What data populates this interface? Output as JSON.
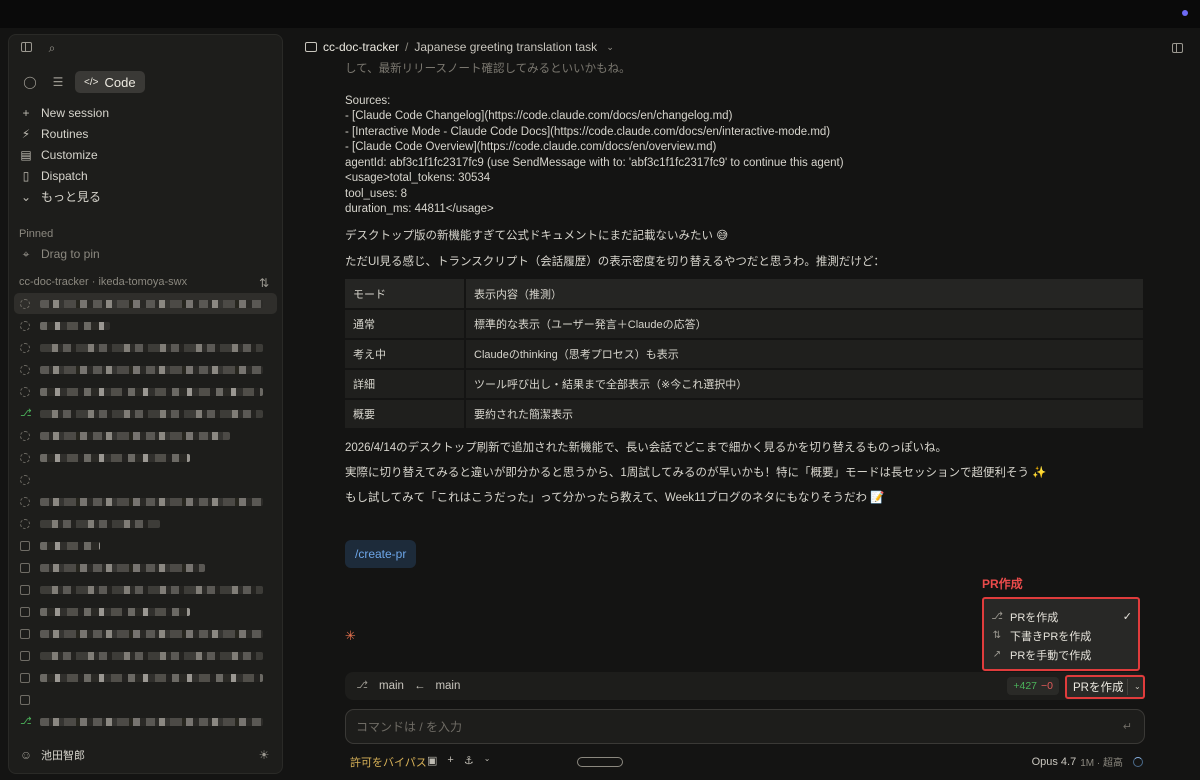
{
  "sidebar": {
    "mode": "Code",
    "nav": [
      {
        "icon": "plus-icon",
        "label": "New session"
      },
      {
        "icon": "routines-icon",
        "label": "Routines"
      },
      {
        "icon": "briefcase-icon",
        "label": "Customize"
      },
      {
        "icon": "dispatch-icon",
        "label": "Dispatch"
      },
      {
        "icon": "chevron-down-icon",
        "label": "もっと見る"
      }
    ],
    "pinned_label": "Pinned",
    "pin_placeholder": "Drag to pin",
    "project": "cc-doc-tracker · ikeda-tomoya-swx",
    "user": "池田智郎"
  },
  "header": {
    "project": "cc-doc-tracker",
    "separator": "/",
    "task": "Japanese greeting translation task"
  },
  "transcript": {
    "faded": "して、最新リリースノート確認してみるといいかもね。",
    "sources_label": "Sources:",
    "sources": [
      "- [Claude Code Changelog](https://code.claude.com/docs/en/changelog.md)",
      "- [Interactive Mode - Claude Code Docs](https://code.claude.com/docs/en/interactive-mode.md)",
      "- [Claude Code Overview](https://code.claude.com/docs/en/overview.md)",
      "agentId: abf3c1f1fc2317fc9 (use SendMessage with to: 'abf3c1f1fc2317fc9' to continue this agent)",
      "<usage>total_tokens: 30534",
      "tool_uses: 8",
      "duration_ms: 44811</usage>"
    ],
    "p1": "デスクトップ版の新機能すぎて公式ドキュメントにまだ記載ないみたい 😅",
    "p2": "ただUI見る感じ、トランスクリプト（会話履歴）の表示密度を切り替えるやつだと思うわ。推測だけど：",
    "table": {
      "headers": [
        "モード",
        "表示内容（推測）"
      ],
      "rows": [
        [
          "通常",
          "標準的な表示（ユーザー発言＋Claudeの応答）"
        ],
        [
          "考え中",
          "Claudeのthinking（思考プロセス）も表示"
        ],
        [
          "詳細",
          "ツール呼び出し・結果まで全部表示（※今これ選択中）"
        ],
        [
          "概要",
          "要約された簡潔表示"
        ]
      ]
    },
    "p3": "2026/4/14のデスクトップ刷新で追加された新機能で、長い会話でどこまで細かく見るかを切り替えるものっぽいね。",
    "p4": "実際に切り替えてみると違いが即分かると思うから、1周試してみるのが早いかも！特に「概要」モードは長セッションで超便利そう ✨",
    "p5": "もし試してみて「これはこうだった」って分かったら教えて、Week11ブログのネタにもなりそうだわ 📝",
    "command": "/create-pr"
  },
  "pr_menu": {
    "annotation": "PR作成",
    "items": [
      {
        "icon": "pull-request-icon",
        "label": "PRを作成",
        "checked": true
      },
      {
        "icon": "draft-pr-icon",
        "label": "下書きPRを作成"
      },
      {
        "icon": "external-link-icon",
        "label": "PRを手動で作成"
      }
    ]
  },
  "branch": {
    "from": "main",
    "arrow": "←",
    "to": "main",
    "additions": "+427",
    "deletions": "−0",
    "button": "PRを作成"
  },
  "composer": {
    "placeholder": "コマンドは / を入力"
  },
  "footer": {
    "permission": "許可をバイパス",
    "model": "Opus 4.7",
    "model_detail": "1M · 超高"
  }
}
